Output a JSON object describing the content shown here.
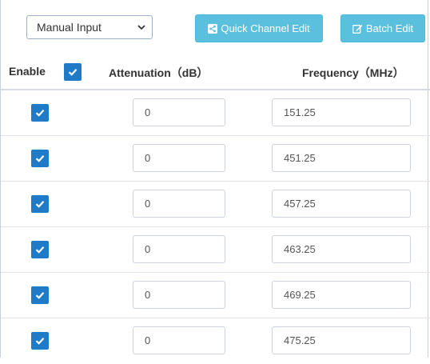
{
  "toolbar": {
    "mode_select": {
      "value": "Manual Input"
    },
    "quick_channel_edit_label": "Quick Channel Edit",
    "batch_edit_label": "Batch Edit"
  },
  "header": {
    "enable": "Enable",
    "attenuation": "Attenuation（dB）",
    "frequency": "Frequency（MHz）",
    "enable_all_checked": true
  },
  "rows": [
    {
      "enabled": true,
      "attenuation": "0",
      "frequency": "151.25"
    },
    {
      "enabled": true,
      "attenuation": "0",
      "frequency": "451.25"
    },
    {
      "enabled": true,
      "attenuation": "0",
      "frequency": "457.25"
    },
    {
      "enabled": true,
      "attenuation": "0",
      "frequency": "463.25"
    },
    {
      "enabled": true,
      "attenuation": "0",
      "frequency": "469.25"
    },
    {
      "enabled": true,
      "attenuation": "0",
      "frequency": "475.25"
    }
  ],
  "colors": {
    "accent_button": "#5bc0de",
    "checkbox": "#1f7bc8"
  }
}
